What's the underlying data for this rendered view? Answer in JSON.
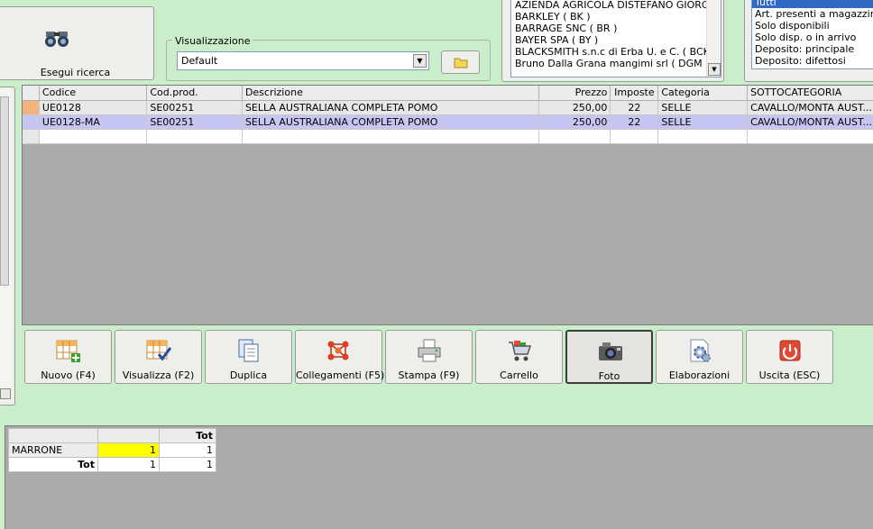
{
  "search": {
    "button_label": "Esegui ricerca",
    "icon": "binoculars-icon"
  },
  "view": {
    "legend": "Visualizzazione",
    "selected": "Default"
  },
  "suppliers": [
    "AZIENDA AGRICOLA DISTEFANO GIORGIO (",
    "BARKLEY  ( BK )",
    "BARRAGE SNC  ( BR )",
    "BAYER SPA  ( BY )",
    "BLACKSMITH s.n.c di Erba U. e C. ( BCK )",
    "Bruno Dalla Grana mangimi srl  ( DGM )"
  ],
  "availability": [
    {
      "label": "Tutti",
      "selected": true
    },
    {
      "label": "Art. presenti a magazzino",
      "selected": false
    },
    {
      "label": "Solo disponibili",
      "selected": false
    },
    {
      "label": "Solo disp. o in arrivo",
      "selected": false
    },
    {
      "label": "Deposito: principale",
      "selected": false
    },
    {
      "label": "Deposito: difettosi",
      "selected": false
    }
  ],
  "grid": {
    "headers": [
      "Codice",
      "Cod.prod.",
      "Descrizione",
      "Prezzo",
      "Imposte",
      "Categoria",
      "SOTTOCATEGORIA"
    ],
    "rows": [
      [
        "UE0128",
        "SE00251",
        "SELLA AUSTRALIANA COMPLETA POMO",
        "250,00",
        "22",
        "SELLE",
        "CAVALLO/MONTA AUST..."
      ],
      [
        "UE0128-MA",
        "SE00251",
        "SELLA AUSTRALIANA COMPLETA POMO",
        "250,00",
        "22",
        "SELLE",
        "CAVALLO/MONTA AUST..."
      ],
      [
        "",
        "",
        "",
        "",
        "",
        "",
        ""
      ]
    ]
  },
  "toolbar": [
    {
      "label": "Nuovo (F4)",
      "icon": "new-grid-icon",
      "pressed": false
    },
    {
      "label": "Visualizza (F2)",
      "icon": "view-grid-icon",
      "pressed": false
    },
    {
      "label": "Duplica",
      "icon": "duplicate-icon",
      "pressed": false
    },
    {
      "label": "Collegamenti (F5)",
      "icon": "links-icon",
      "pressed": false
    },
    {
      "label": "Stampa (F9)",
      "icon": "printer-icon",
      "pressed": false
    },
    {
      "label": "Carrello",
      "icon": "cart-icon",
      "pressed": false
    },
    {
      "label": "Foto",
      "icon": "camera-icon",
      "pressed": true
    },
    {
      "label": "Elaborazioni",
      "icon": "process-icon",
      "pressed": false
    },
    {
      "label": "Uscita (ESC)",
      "icon": "exit-icon",
      "pressed": false
    }
  ],
  "pivot": {
    "col_header": "Tot",
    "row_label": "MARRONE",
    "row_value": "1",
    "row_total": "1",
    "total_label": "Tot",
    "total_value": "1",
    "grand_total": "1"
  },
  "colors": {
    "background": "#c9eec9",
    "selection": "#316ac5",
    "row_highlight": "#c6c6f3",
    "current_row_marker": "#f4b37a",
    "pivot_highlight": "#ffff00"
  }
}
